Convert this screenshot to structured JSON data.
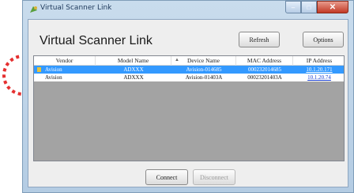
{
  "window": {
    "title": "Virtual Scanner Link",
    "heading": "Virtual Scanner Link",
    "controls": {
      "minimize": "–",
      "maximize": "□",
      "close": "✕"
    }
  },
  "toolbar": {
    "refresh_label": "Refresh",
    "options_label": "Options"
  },
  "table": {
    "columns": [
      "Vendor",
      "Model Name",
      "Device Name",
      "MAC Address",
      "IP Address"
    ],
    "sorted_column": "Device Name",
    "rows": [
      {
        "vendor": "Avision",
        "model": "ADXXX",
        "device": "Avision-014685",
        "mac": "000232014685",
        "ip": "10.1.20.171",
        "selected": true
      },
      {
        "vendor": "Avision",
        "model": "ADXXX",
        "device": "Avision-01403A",
        "mac": "00023201403A",
        "ip": "10.1.20.74",
        "selected": false
      }
    ]
  },
  "footer": {
    "connect_label": "Connect",
    "disconnect_label": "Disconnect"
  },
  "colors": {
    "selection": "#3399ff",
    "annotation": "#e53030",
    "link": "#1a3fd0"
  },
  "icons": [
    "scanner-app-icon",
    "device-row-icon"
  ]
}
